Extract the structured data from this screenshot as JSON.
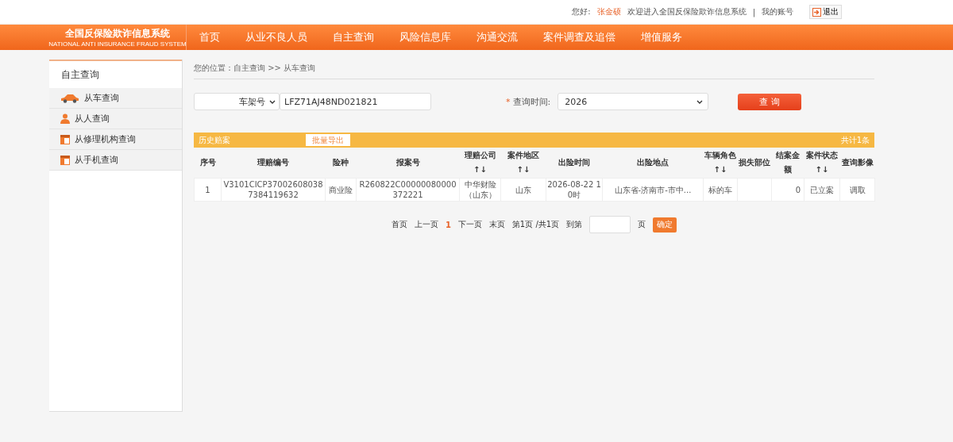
{
  "top_bar": {
    "greeting": "您好:",
    "user": "张金硕",
    "welcome": "欢迎进入全国反保险欺诈信息系统",
    "separator": "|",
    "account": "我的账号",
    "logout": "退出"
  },
  "logo": {
    "title": "全国反保险欺诈信息系统",
    "subtitle": "NATIONAL ANTI INSURANCE FRAUD SYSTEM"
  },
  "nav": [
    "首页",
    "从业不良人员",
    "自主查询",
    "风险信息库",
    "沟通交流",
    "案件调查及追偿",
    "增值服务"
  ],
  "sidebar": {
    "title": "自主查询",
    "items": [
      {
        "label": "从车查询",
        "kind": "car"
      },
      {
        "label": "从人查询",
        "kind": "person"
      },
      {
        "label": "从修理机构查询",
        "kind": "calendar"
      },
      {
        "label": "从手机查询",
        "kind": "calendar"
      }
    ]
  },
  "breadcrumb": "您的位置：自主查询 >> 从车查询",
  "search": {
    "type_select": "车架号",
    "value": "LFZ71AJ48ND021821",
    "required_mark": "*",
    "time_label": "查询时间:",
    "time_select": "2026",
    "button": "查 询"
  },
  "table": {
    "title": "历史赔案",
    "export": "批量导出",
    "total": "共计1条",
    "columns": [
      "序号",
      "理赔编号",
      "险种",
      "报案号",
      "理赔公司↑↓",
      "案件地区↑↓",
      "出险时间",
      "出险地点",
      "车辆角色↑↓",
      "损失部位",
      "结案金额",
      "案件状态↑↓",
      "查询影像"
    ],
    "rows": [
      [
        "1",
        "V3101CICP370026080387384119632",
        "商业险",
        "R260822C00000080000372221",
        "中华财险（山东）",
        "山东",
        "2026-08-22 10时",
        "山东省-济南市-市中...",
        "标的车",
        "",
        "0",
        "已立案",
        "调取"
      ]
    ]
  },
  "pagination": {
    "first": "首页",
    "prev": "上一页",
    "pages": [
      {
        "label": "1",
        "selected": true
      }
    ],
    "next": "下一页",
    "last": "末页",
    "info": "第1页 /共1页",
    "goto": "到第",
    "unit": "页",
    "confirm": "确定"
  }
}
